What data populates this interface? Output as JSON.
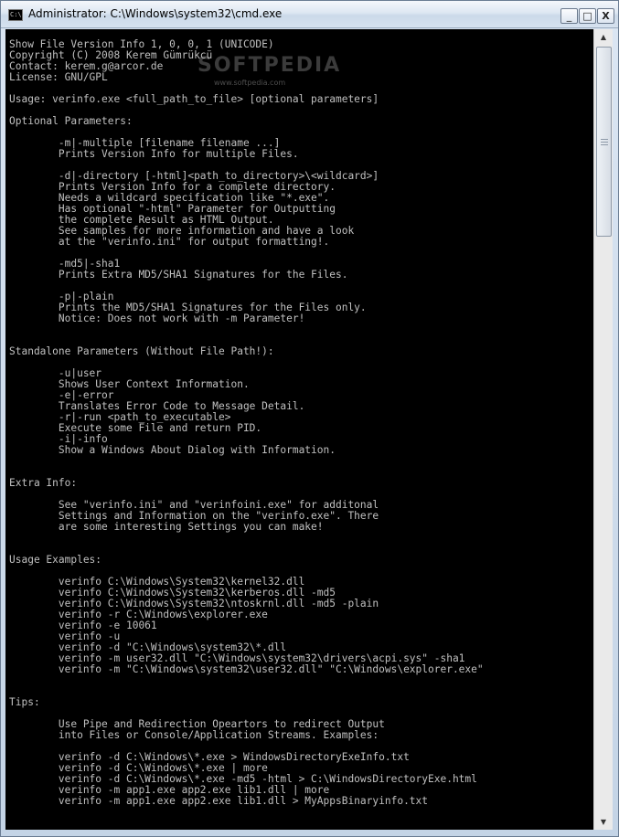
{
  "window": {
    "title": "Administrator: C:\\Windows\\system32\\cmd.exe",
    "icon_text": "C:\\",
    "buttons": {
      "minimize": "_",
      "maximize": "□",
      "close": "X"
    }
  },
  "watermark": {
    "main": "SOFTPEDIA",
    "sub": "www.softpedia.com"
  },
  "scrollbar": {
    "up_glyph": "▲",
    "down_glyph": "▼"
  },
  "console": {
    "lines": [
      "Show File Version Info 1, 0, 0, 1 (UNICODE)",
      "Copyright (C) 2008 Kerem Gümrükcü",
      "Contact: kerem.g@arcor.de",
      "License: GNU/GPL",
      "",
      "Usage: verinfo.exe <full_path_to_file> [optional parameters]",
      "",
      "Optional Parameters:",
      "",
      "        -m|-multiple [filename filename ...]",
      "        Prints Version Info for multiple Files.",
      "",
      "        -d|-directory [-html]<path_to_directory>\\<wildcard>]",
      "        Prints Version Info for a complete directory.",
      "        Needs a wildcard specification like \"*.exe\".",
      "        Has optional \"-html\" Parameter for Outputting",
      "        the complete Result as HTML Output.",
      "        See samples for more information and have a look",
      "        at the \"verinfo.ini\" for output formatting!.",
      "",
      "        -md5|-sha1",
      "        Prints Extra MD5/SHA1 Signatures for the Files.",
      "",
      "        -p|-plain",
      "        Prints the MD5/SHA1 Signatures for the Files only.",
      "        Notice: Does not work with -m Parameter!",
      "",
      "",
      "Standalone Parameters (Without File Path!):",
      "",
      "        -u|user",
      "        Shows User Context Information.",
      "        -e|-error",
      "        Translates Error Code to Message Detail.",
      "        -r|-run <path_to_executable>",
      "        Execute some File and return PID.",
      "        -i|-info",
      "        Show a Windows About Dialog with Information.",
      "",
      "",
      "Extra Info:",
      "",
      "        See \"verinfo.ini\" and \"verinfoini.exe\" for additonal",
      "        Settings and Information on the \"verinfo.exe\". There",
      "        are some interesting Settings you can make!",
      "",
      "",
      "Usage Examples:",
      "",
      "        verinfo C:\\Windows\\System32\\kernel32.dll",
      "        verinfo C:\\Windows\\System32\\kerberos.dll -md5",
      "        verinfo C:\\Windows\\System32\\ntoskrnl.dll -md5 -plain",
      "        verinfo -r C:\\Windows\\explorer.exe",
      "        verinfo -e 10061",
      "        verinfo -u",
      "        verinfo -d \"C:\\Windows\\system32\\*.dll",
      "        verinfo -m user32.dll \"C:\\Windows\\system32\\drivers\\acpi.sys\" -sha1",
      "        verinfo -m \"C:\\Windows\\system32\\user32.dll\" \"C:\\Windows\\explorer.exe\"",
      "",
      "",
      "Tips:",
      "",
      "        Use Pipe and Redirection Opeartors to redirect Output",
      "        into Files or Console/Application Streams. Examples:",
      "",
      "        verinfo -d C:\\Windows\\*.exe > WindowsDirectoryExeInfo.txt",
      "        verinfo -d C:\\Windows\\*.exe | more",
      "        verinfo -d C:\\Windows\\*.exe -md5 -html > C:\\WindowsDirectoryExe.html",
      "        verinfo -m app1.exe app2.exe lib1.dll | more",
      "        verinfo -m app1.exe app2.exe lib1.dll > MyAppsBinaryinfo.txt"
    ]
  }
}
